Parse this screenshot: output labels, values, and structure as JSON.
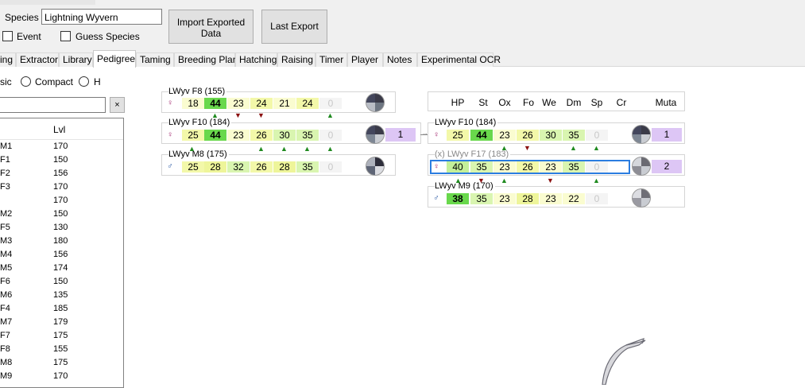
{
  "header": {
    "species_label": "Species",
    "species_value": "Lightning Wyvern",
    "event_label": "Event",
    "guess_species_label": "Guess Species",
    "import_button": "Import Exported Data",
    "last_export_button": "Last Export"
  },
  "tabs": [
    "ing",
    "Extractor",
    "Library",
    "Pedigree",
    "Taming",
    "Breeding Plan",
    "Hatching",
    "Raising",
    "Timer",
    "Player",
    "Notes",
    "Experimental OCR"
  ],
  "active_tab": "Pedigree",
  "view_options": {
    "classic": "sic",
    "compact": "Compact",
    "h": "H"
  },
  "filter": {
    "value": "",
    "clear": "×"
  },
  "library_list": {
    "col_lvl": "Lvl",
    "rows": [
      {
        "name": "M1",
        "lvl": "170"
      },
      {
        "name": "F1",
        "lvl": "150"
      },
      {
        "name": "F2",
        "lvl": "156"
      },
      {
        "name": "F3",
        "lvl": "170"
      },
      {
        "name": "",
        "lvl": "170"
      },
      {
        "name": "M2",
        "lvl": "150"
      },
      {
        "name": "F5",
        "lvl": "130"
      },
      {
        "name": "M3",
        "lvl": "180"
      },
      {
        "name": "M4",
        "lvl": "156"
      },
      {
        "name": "M5",
        "lvl": "174"
      },
      {
        "name": "F6",
        "lvl": "150"
      },
      {
        "name": "M6",
        "lvl": "135"
      },
      {
        "name": "F4",
        "lvl": "185"
      },
      {
        "name": "M7",
        "lvl": "179"
      },
      {
        "name": "F7",
        "lvl": "175"
      },
      {
        "name": "F8",
        "lvl": "155"
      },
      {
        "name": "M8",
        "lvl": "175"
      },
      {
        "name": "M9",
        "lvl": "170"
      }
    ]
  },
  "stat_headers": [
    "HP",
    "St",
    "Ox",
    "Fo",
    "We",
    "Dm",
    "Sp",
    "Cr"
  ],
  "muta_header": "Muta",
  "left_tree": [
    {
      "name": "LWyv F8 (155)",
      "stats": [
        "18",
        "44",
        "23",
        "24",
        "21",
        "24",
        "0"
      ],
      "muta": ""
    },
    {
      "name": "LWyv F10 (184)",
      "stats": [
        "25",
        "44",
        "23",
        "26",
        "30",
        "35",
        "0"
      ],
      "muta": "1"
    },
    {
      "name": "LWyv M8 (175)",
      "stats": [
        "25",
        "28",
        "32",
        "26",
        "28",
        "35",
        "0"
      ],
      "muta": ""
    }
  ],
  "right_tree": [
    {
      "name": "LWyv F10 (184)",
      "stats": [
        "25",
        "44",
        "23",
        "26",
        "30",
        "35",
        "0"
      ],
      "muta": "1"
    },
    {
      "name": "(x) LWyv F17 (183)",
      "stats": [
        "40",
        "35",
        "23",
        "26",
        "23",
        "35",
        "0"
      ],
      "muta": "2"
    },
    {
      "name": "LWyv M9 (170)",
      "stats": [
        "38",
        "35",
        "23",
        "28",
        "23",
        "22",
        "0"
      ],
      "muta": ""
    }
  ],
  "colors": {
    "muta_bg": "#ddc6f5",
    "selected_border": "#2b7de0",
    "up_arrow": "#1f8a1f",
    "down_arrow": "#8b1010"
  }
}
